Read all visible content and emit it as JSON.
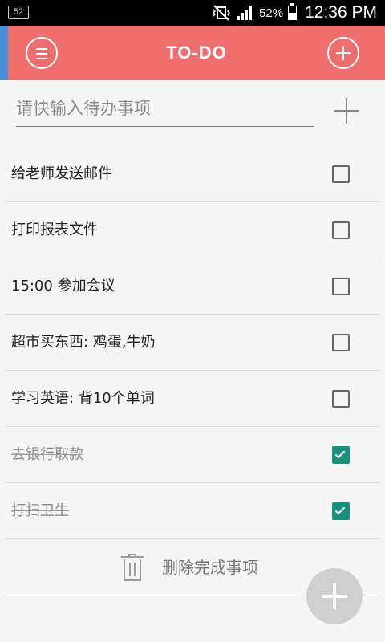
{
  "status_bar": {
    "notification_badge": "52",
    "battery_percent": "52%",
    "battery_level": 0.52,
    "time": "12:36 PM",
    "icons": [
      "mute-vibrate-icon",
      "signal-icon",
      "battery-icon"
    ]
  },
  "app_bar": {
    "title": "TO-DO",
    "background": "#ef6e6e",
    "left_icon": "menu-icon",
    "right_icon": "add-circle-icon"
  },
  "input": {
    "placeholder": "请快输入待办事项",
    "value": "",
    "add_icon": "plus-icon"
  },
  "todos": [
    {
      "label": "给老师发送邮件",
      "done": false
    },
    {
      "label": "打印报表文件",
      "done": false
    },
    {
      "label": "15:00 参加会议",
      "done": false
    },
    {
      "label": "超市买东西: 鸡蛋,牛奶",
      "done": false
    },
    {
      "label": "学习英语: 背10个单词",
      "done": false
    },
    {
      "label": "去银行取款",
      "done": true
    },
    {
      "label": "打扫卫生",
      "done": true
    }
  ],
  "delete_done": {
    "label": "删除完成事项",
    "icon": "trash-icon"
  },
  "fab": {
    "icon": "plus-icon"
  },
  "colors": {
    "accent": "#ef6e6e",
    "checked": "#1a8f7e",
    "edge": "#4a8fd6"
  }
}
